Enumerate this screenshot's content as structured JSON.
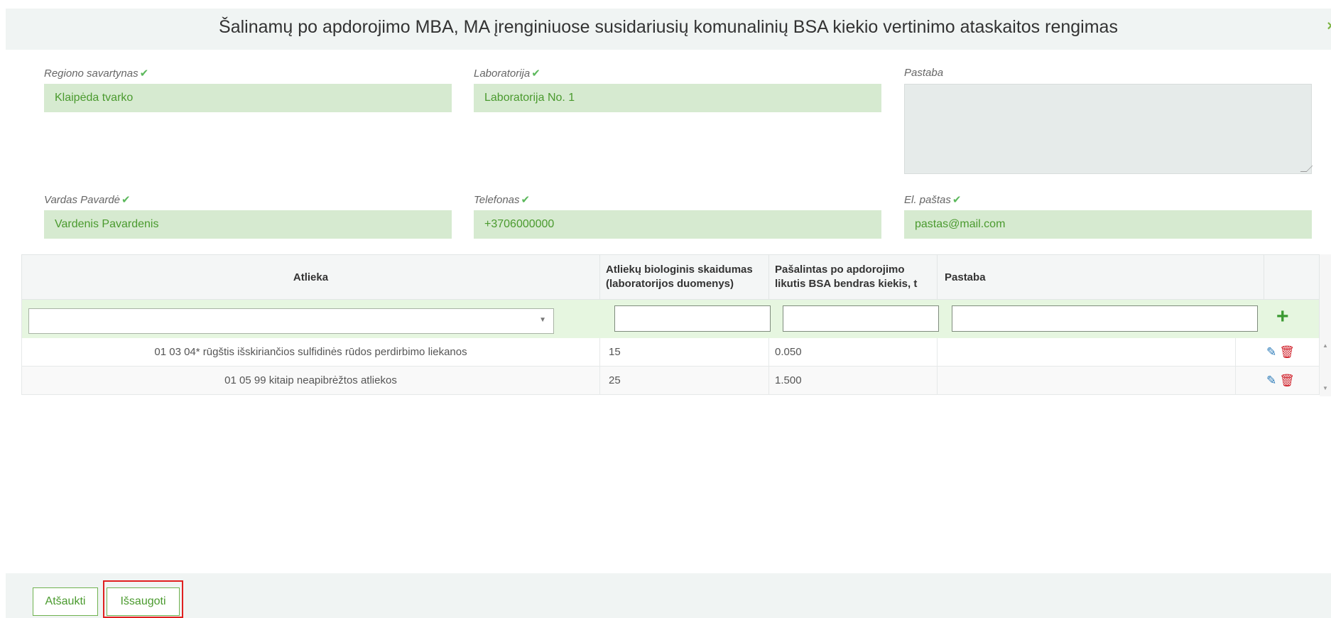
{
  "dialog": {
    "title": "Šalinamų po apdorojimo MBA, MA įrenginiuose susidariusių komunalinių BSA kiekio vertinimo ataskaitos rengimas",
    "close_glyph": "×"
  },
  "form": {
    "region_label": "Regiono savartynas",
    "region_value": "Klaipėda tvarko",
    "lab_label": "Laboratorija",
    "lab_value": "Laboratorija No. 1",
    "note_label": "Pastaba",
    "name_label": "Vardas Pavardė",
    "name_value": "Vardenis Pavardenis",
    "phone_label": "Telefonas",
    "phone_value": "+3706000000",
    "email_label": "El. paštas",
    "email_value": "pastas@mail.com",
    "check_glyph": "✔"
  },
  "table": {
    "headers": {
      "waste": "Atlieka",
      "bio": "Atliekų biologinis skaidumas (laboratorijos duomenys)",
      "removed": "Pašalintas po apdorojimo likutis BSA bendras kiekis, t",
      "note": "Pastaba"
    },
    "add_glyph": "+",
    "rows": [
      {
        "waste": "01 03 04* rūgštis išskiriančios sulfidinės rūdos perdirbimo liekanos",
        "bio": "15",
        "removed": "0.050",
        "note": ""
      },
      {
        "waste": "01 05 99 kitaip neapibrėžtos atliekos",
        "bio": "25",
        "removed": "1.500",
        "note": ""
      }
    ]
  },
  "footer": {
    "cancel_label": "Atšaukti",
    "save_label": "Išsaugoti"
  },
  "colors": {
    "accent": "#4a9a2e",
    "field_bg": "#d6ead0",
    "highlight": "#e02020"
  }
}
